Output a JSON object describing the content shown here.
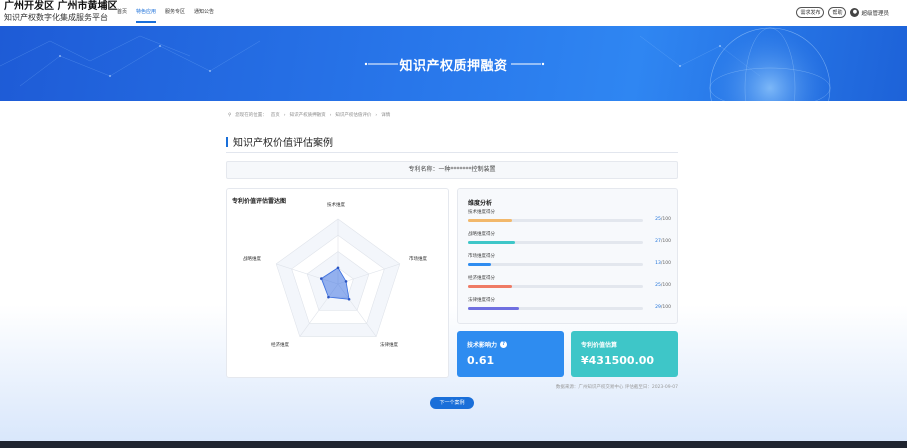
{
  "header": {
    "brand_title": "广州开发区 广州市黄埔区",
    "brand_subtitle": "知识产权数字化集成服务平台",
    "nav": [
      {
        "label": "首页"
      },
      {
        "label": "特色应用"
      },
      {
        "label": "服务专区"
      },
      {
        "label": "通知公告"
      }
    ],
    "publish_label": "需求发布",
    "help_label": "帮助",
    "user_label": "超级管理员"
  },
  "banner": {
    "title": "知识产权质押融资"
  },
  "breadcrumb": {
    "prefix": "您现在的位置：",
    "items": [
      "首页",
      "知识产权质押融资",
      "知识产权估值评价",
      "详情"
    ]
  },
  "section_title": "知识产权价值评估案例",
  "patent": {
    "label": "专利名称：一种*******控制装置"
  },
  "radar": {
    "title": "专利价值评估雷达图",
    "axes": [
      {
        "label": "技术维度",
        "value": 25
      },
      {
        "label": "市场维度",
        "value": 13
      },
      {
        "label": "法律维度",
        "value": 29
      },
      {
        "label": "经济维度",
        "value": 25
      },
      {
        "label": "战略维度",
        "value": 27
      }
    ],
    "max": 100,
    "color": "#3b6fe0"
  },
  "dimension": {
    "title": "维度分析",
    "items": [
      {
        "label": "技术维度得分",
        "score": 25,
        "max": "/100",
        "color": "#f2b86b"
      },
      {
        "label": "战略维度得分",
        "score": 27,
        "max": "/100",
        "color": "#3ec6c8"
      },
      {
        "label": "市场维度得分",
        "score": 13,
        "max": "/100",
        "color": "#2e8cf0"
      },
      {
        "label": "经济维度得分",
        "score": 25,
        "max": "/100",
        "color": "#ef7b65"
      },
      {
        "label": "法律维度得分",
        "score": 29,
        "max": "/100",
        "color": "#6f6fe0"
      }
    ]
  },
  "metrics": {
    "influence_label": "技术影响力",
    "influence_value": "0.61",
    "value_label": "专利价值估算",
    "value_value": "¥431500.00"
  },
  "source_text": "数据来源：广州知识产权交易中心  评估截至日：2023-09-07",
  "next_button": "下一个案例"
}
